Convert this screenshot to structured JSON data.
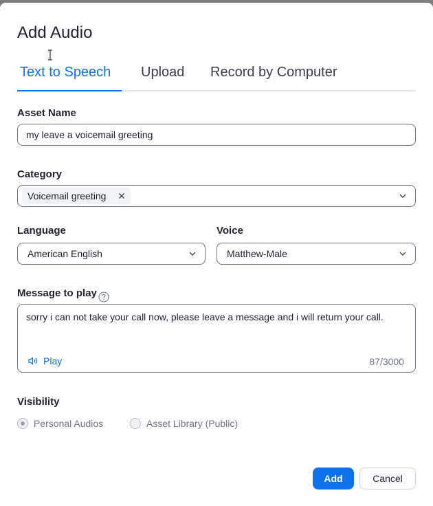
{
  "dialog": {
    "title": "Add Audio"
  },
  "tabs": [
    {
      "label": "Text to Speech",
      "active": true
    },
    {
      "label": "Upload",
      "active": false
    },
    {
      "label": "Record by Computer",
      "active": false
    }
  ],
  "asset_name": {
    "label": "Asset Name",
    "value": "my leave a voicemail greeting"
  },
  "category": {
    "label": "Category",
    "selected_chip": "Voicemail greeting"
  },
  "language": {
    "label": "Language",
    "value": "American English"
  },
  "voice": {
    "label": "Voice",
    "value": "Matthew-Male"
  },
  "message": {
    "label": "Message to play",
    "text": "sorry i can not take your call now, please leave a message and i will return your call.",
    "play_label": "Play",
    "counter": "87/3000"
  },
  "visibility": {
    "label": "Visibility",
    "options": [
      {
        "label": "Personal Audios",
        "checked": true,
        "disabled": true
      },
      {
        "label": "Asset Library (Public)",
        "checked": false,
        "disabled": true
      }
    ]
  },
  "footer": {
    "add_label": "Add",
    "cancel_label": "Cancel"
  },
  "colors": {
    "accent": "#0e72ed",
    "text": "#222230",
    "muted": "#6e7680"
  }
}
